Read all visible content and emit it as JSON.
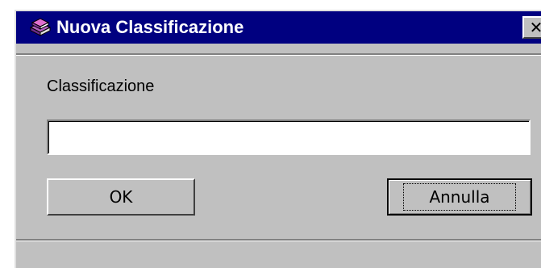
{
  "window": {
    "title": "Nuova Classificazione",
    "close_label": "✕"
  },
  "form": {
    "field_label": "Classificazione",
    "field_value": "",
    "field_placeholder": ""
  },
  "buttons": {
    "ok_label": "OK",
    "cancel_label": "Annulla"
  },
  "colors": {
    "titlebar": "#000080",
    "face": "#c0c0c0"
  },
  "icons": {
    "app": "books-icon",
    "close": "close-icon"
  }
}
